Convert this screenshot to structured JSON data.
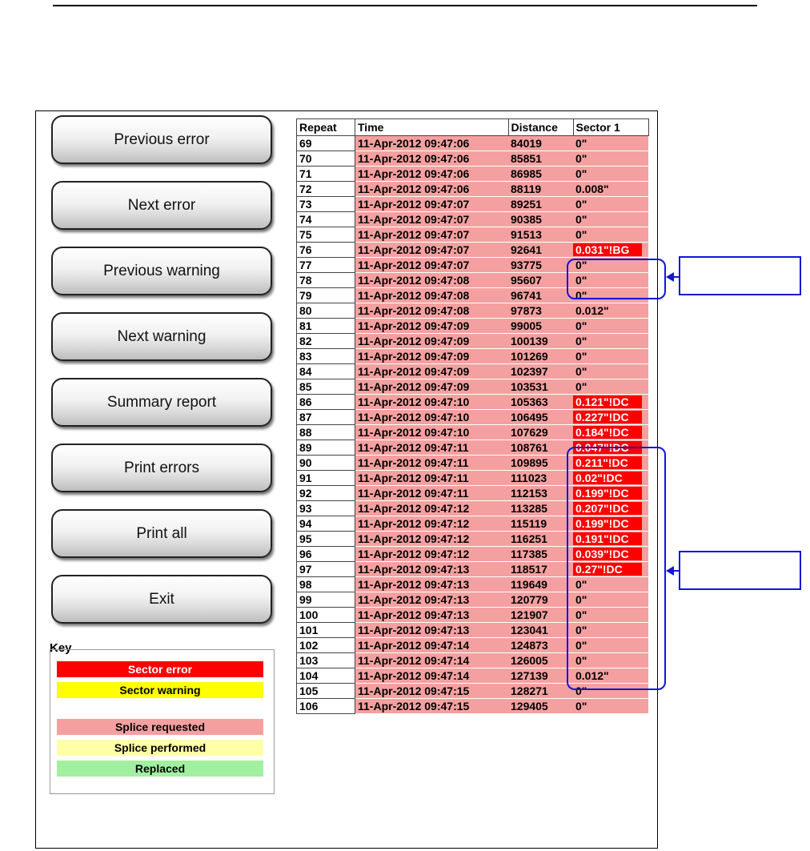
{
  "buttons": [
    {
      "name": "previous-error-button",
      "label": "Previous error"
    },
    {
      "name": "next-error-button",
      "label": "Next error"
    },
    {
      "name": "previous-warning-button",
      "label": "Previous warning"
    },
    {
      "name": "next-warning-button",
      "label": "Next warning"
    },
    {
      "name": "summary-report-button",
      "label": "Summary report"
    },
    {
      "name": "print-errors-button",
      "label": "Print errors"
    },
    {
      "name": "print-all-button",
      "label": "Print all"
    },
    {
      "name": "exit-button",
      "label": "Exit"
    }
  ],
  "key": {
    "title": "Key",
    "items": [
      {
        "label": "Sector error",
        "bg": "#ff0000",
        "color": "#ffffff"
      },
      {
        "label": "Sector warning",
        "bg": "#ffff00",
        "color": "#000000"
      },
      {
        "label": "Splice requested",
        "bg": "#f5a0a0",
        "color": "#000000"
      },
      {
        "label": "Splice performed",
        "bg": "#ffffa8",
        "color": "#000000"
      },
      {
        "label": "Replaced",
        "bg": "#a0f0a0",
        "color": "#000000"
      }
    ]
  },
  "table": {
    "headers": [
      "Repeat",
      "Time",
      "Distance",
      "Sector 1"
    ],
    "rows": [
      {
        "repeat": "69",
        "time": "11-Apr-2012 09:47:06",
        "distance": "84019",
        "sector": "0\"",
        "error": false
      },
      {
        "repeat": "70",
        "time": "11-Apr-2012 09:47:06",
        "distance": "85851",
        "sector": "0\"",
        "error": false
      },
      {
        "repeat": "71",
        "time": "11-Apr-2012 09:47:06",
        "distance": "86985",
        "sector": "0\"",
        "error": false
      },
      {
        "repeat": "72",
        "time": "11-Apr-2012 09:47:06",
        "distance": "88119",
        "sector": "0.008\"",
        "error": false
      },
      {
        "repeat": "73",
        "time": "11-Apr-2012 09:47:07",
        "distance": "89251",
        "sector": "0\"",
        "error": false
      },
      {
        "repeat": "74",
        "time": "11-Apr-2012 09:47:07",
        "distance": "90385",
        "sector": "0\"",
        "error": false
      },
      {
        "repeat": "75",
        "time": "11-Apr-2012 09:47:07",
        "distance": "91513",
        "sector": "0\"",
        "error": false
      },
      {
        "repeat": "76",
        "time": "11-Apr-2012 09:47:07",
        "distance": "92641",
        "sector": "0.031\"!BG",
        "error": true
      },
      {
        "repeat": "77",
        "time": "11-Apr-2012 09:47:07",
        "distance": "93775",
        "sector": "0\"",
        "error": false
      },
      {
        "repeat": "78",
        "time": "11-Apr-2012 09:47:08",
        "distance": "95607",
        "sector": "0\"",
        "error": false
      },
      {
        "repeat": "79",
        "time": "11-Apr-2012 09:47:08",
        "distance": "96741",
        "sector": "0\"",
        "error": false
      },
      {
        "repeat": "80",
        "time": "11-Apr-2012 09:47:08",
        "distance": "97873",
        "sector": "0.012\"",
        "error": false
      },
      {
        "repeat": "81",
        "time": "11-Apr-2012 09:47:09",
        "distance": "99005",
        "sector": "0\"",
        "error": false
      },
      {
        "repeat": "82",
        "time": "11-Apr-2012 09:47:09",
        "distance": "100139",
        "sector": "0\"",
        "error": false
      },
      {
        "repeat": "83",
        "time": "11-Apr-2012 09:47:09",
        "distance": "101269",
        "sector": "0\"",
        "error": false
      },
      {
        "repeat": "84",
        "time": "11-Apr-2012 09:47:09",
        "distance": "102397",
        "sector": "0\"",
        "error": false
      },
      {
        "repeat": "85",
        "time": "11-Apr-2012 09:47:09",
        "distance": "103531",
        "sector": "0\"",
        "error": false
      },
      {
        "repeat": "86",
        "time": "11-Apr-2012 09:47:10",
        "distance": "105363",
        "sector": "0.121\"!DC",
        "error": true
      },
      {
        "repeat": "87",
        "time": "11-Apr-2012 09:47:10",
        "distance": "106495",
        "sector": "0.227\"!DC",
        "error": true
      },
      {
        "repeat": "88",
        "time": "11-Apr-2012 09:47:10",
        "distance": "107629",
        "sector": "0.184\"!DC",
        "error": true
      },
      {
        "repeat": "89",
        "time": "11-Apr-2012 09:47:11",
        "distance": "108761",
        "sector": "0.047\"!DC",
        "error": true
      },
      {
        "repeat": "90",
        "time": "11-Apr-2012 09:47:11",
        "distance": "109895",
        "sector": "0.211\"!DC",
        "error": true
      },
      {
        "repeat": "91",
        "time": "11-Apr-2012 09:47:11",
        "distance": "111023",
        "sector": "0.02\"!DC",
        "error": true
      },
      {
        "repeat": "92",
        "time": "11-Apr-2012 09:47:11",
        "distance": "112153",
        "sector": "0.199\"!DC",
        "error": true
      },
      {
        "repeat": "93",
        "time": "11-Apr-2012 09:47:12",
        "distance": "113285",
        "sector": "0.207\"!DC",
        "error": true
      },
      {
        "repeat": "94",
        "time": "11-Apr-2012 09:47:12",
        "distance": "115119",
        "sector": "0.199\"!DC",
        "error": true
      },
      {
        "repeat": "95",
        "time": "11-Apr-2012 09:47:12",
        "distance": "116251",
        "sector": "0.191\"!DC",
        "error": true
      },
      {
        "repeat": "96",
        "time": "11-Apr-2012 09:47:12",
        "distance": "117385",
        "sector": "0.039\"!DC",
        "error": true
      },
      {
        "repeat": "97",
        "time": "11-Apr-2012 09:47:13",
        "distance": "118517",
        "sector": "0.27\"!DC",
        "error": true
      },
      {
        "repeat": "98",
        "time": "11-Apr-2012 09:47:13",
        "distance": "119649",
        "sector": "0\"",
        "error": false
      },
      {
        "repeat": "99",
        "time": "11-Apr-2012 09:47:13",
        "distance": "120779",
        "sector": "0\"",
        "error": false
      },
      {
        "repeat": "100",
        "time": "11-Apr-2012 09:47:13",
        "distance": "121907",
        "sector": "0\"",
        "error": false
      },
      {
        "repeat": "101",
        "time": "11-Apr-2012 09:47:13",
        "distance": "123041",
        "sector": "0\"",
        "error": false
      },
      {
        "repeat": "102",
        "time": "11-Apr-2012 09:47:14",
        "distance": "124873",
        "sector": "0\"",
        "error": false
      },
      {
        "repeat": "103",
        "time": "11-Apr-2012 09:47:14",
        "distance": "126005",
        "sector": "0\"",
        "error": false
      },
      {
        "repeat": "104",
        "time": "11-Apr-2012 09:47:14",
        "distance": "127139",
        "sector": "0.012\"",
        "error": false
      },
      {
        "repeat": "105",
        "time": "11-Apr-2012 09:47:15",
        "distance": "128271",
        "sector": "0\"",
        "error": false
      },
      {
        "repeat": "106",
        "time": "11-Apr-2012 09:47:15",
        "distance": "129405",
        "sector": "0\"",
        "error": false
      }
    ]
  },
  "colors": {
    "highlight": "#1414d8",
    "error": "#ff0000",
    "splice_requested": "#f5a0a0"
  }
}
